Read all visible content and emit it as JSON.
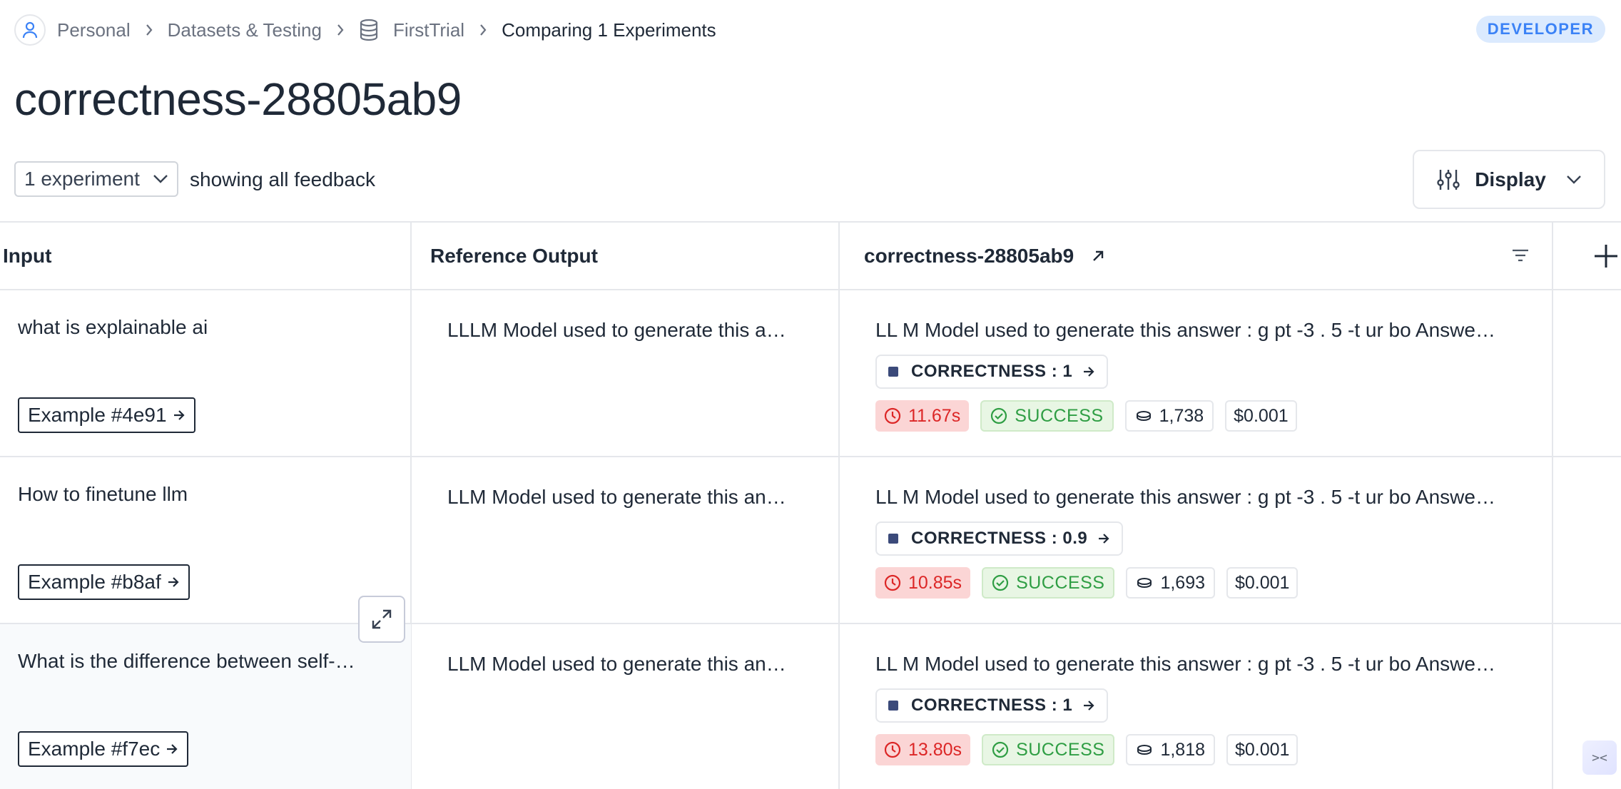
{
  "breadcrumb": {
    "items": [
      "Personal",
      "Datasets & Testing",
      "FirstTrial"
    ],
    "current": "Comparing 1 Experiments"
  },
  "badge": "DEVELOPER",
  "title": "correctness-28805ab9",
  "toolbar": {
    "experiment_select": "1 experiment",
    "feedback_text": "showing all feedback",
    "display_label": "Display"
  },
  "table": {
    "headers": {
      "input": "Input",
      "reference": "Reference Output",
      "experiment": "correctness-28805ab9"
    },
    "rows": [
      {
        "input": "what is explainable ai",
        "example": "Example #4e91",
        "reference": "LLLM Model used to generate this a…",
        "output": "LL M Model used to generate this answer : g pt -3 . 5 -t ur bo Answe…",
        "feedback_key": "CORRECTNESS : ",
        "feedback_value": "1",
        "latency": "11.67s",
        "status": "SUCCESS",
        "tokens": "1,738",
        "cost": "$0.001"
      },
      {
        "input": "How to finetune llm",
        "example": "Example #b8af",
        "reference": "LLM Model used to generate this an…",
        "output": "LL M Model used to generate this answer : g pt -3 . 5 -t ur bo Answe…",
        "feedback_key": "CORRECTNESS : ",
        "feedback_value": "0.9",
        "latency": "10.85s",
        "status": "SUCCESS",
        "tokens": "1,693",
        "cost": "$0.001"
      },
      {
        "input": "What is the difference between self-…",
        "example": "Example #f7ec",
        "reference": "LLM Model used to generate this an…",
        "output": "LL M Model used to generate this answer : g pt -3 . 5 -t ur bo Answe…",
        "feedback_key": "CORRECTNESS : ",
        "feedback_value": "1",
        "latency": "13.80s",
        "status": "SUCCESS",
        "tokens": "1,818",
        "cost": "$0.001"
      }
    ]
  },
  "colors": {
    "accent": "#3b82f6",
    "latency_bg": "#fbd5d5",
    "latency_fg": "#dc2626",
    "success_bg": "#e8f6e4",
    "success_fg": "#2f9e44",
    "feedback_square": "#3b4a7a"
  },
  "icons": [
    "user-icon",
    "chevron-right-icon",
    "database-icon",
    "chevron-down-icon",
    "sliders-icon",
    "arrow-up-right-icon",
    "filter-icon",
    "plus-icon",
    "arrow-right-icon",
    "clock-icon",
    "check-circle-icon",
    "coin-icon",
    "expand-icon"
  ]
}
